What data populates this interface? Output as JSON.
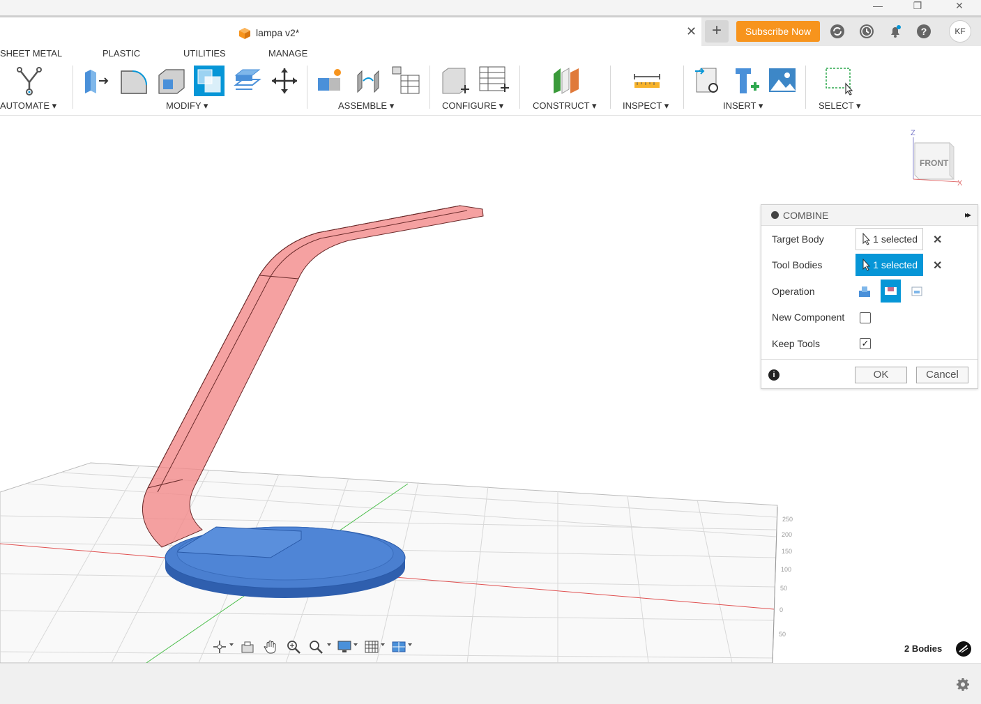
{
  "window": {
    "minimize": "—",
    "restore": "❐",
    "close": "✕"
  },
  "document": {
    "title": "lampa v2*",
    "close": "✕"
  },
  "header": {
    "new_tab": "+",
    "subscribe_label": "Subscribe Now",
    "user_initials": "KF",
    "icons": [
      "sync-icon",
      "history-icon",
      "notifications-icon",
      "help-icon"
    ]
  },
  "workspace_tabs": [
    "SHEET METAL",
    "PLASTIC",
    "UTILITIES",
    "MANAGE"
  ],
  "toolbar_groups": [
    {
      "label": "AUTOMATE ▾"
    },
    {
      "label": "MODIFY ▾"
    },
    {
      "label": "ASSEMBLE ▾"
    },
    {
      "label": "CONFIGURE ▾"
    },
    {
      "label": "CONSTRUCT ▾"
    },
    {
      "label": "INSPECT ▾"
    },
    {
      "label": "INSERT ▾"
    },
    {
      "label": "SELECT ▾"
    }
  ],
  "viewcube": {
    "face": "FRONT",
    "axis_z": "Z",
    "axis_x": "X"
  },
  "combine_panel": {
    "title": "COMBINE",
    "expand": "▸▸",
    "target_body_label": "Target Body",
    "target_body_value": "1 selected",
    "tool_bodies_label": "Tool Bodies",
    "tool_bodies_value": "1 selected",
    "operation_label": "Operation",
    "operation_selected": "cut",
    "new_component_label": "New Component",
    "new_component_checked": false,
    "keep_tools_label": "Keep Tools",
    "keep_tools_checked": true,
    "keep_tools_mark": "✓",
    "clear": "✕",
    "info": "i",
    "ok_label": "OK",
    "cancel_label": "Cancel"
  },
  "ruler_ticks": [
    "250",
    "200",
    "150",
    "100",
    "50",
    "0",
    "50"
  ],
  "status": {
    "bodies_count": "2 Bodies"
  },
  "colors": {
    "accent_blue": "#0696d7",
    "subscribe_orange": "#f7941d",
    "lamp_arm": "#f08080",
    "lamp_base": "#3f6fc2"
  }
}
